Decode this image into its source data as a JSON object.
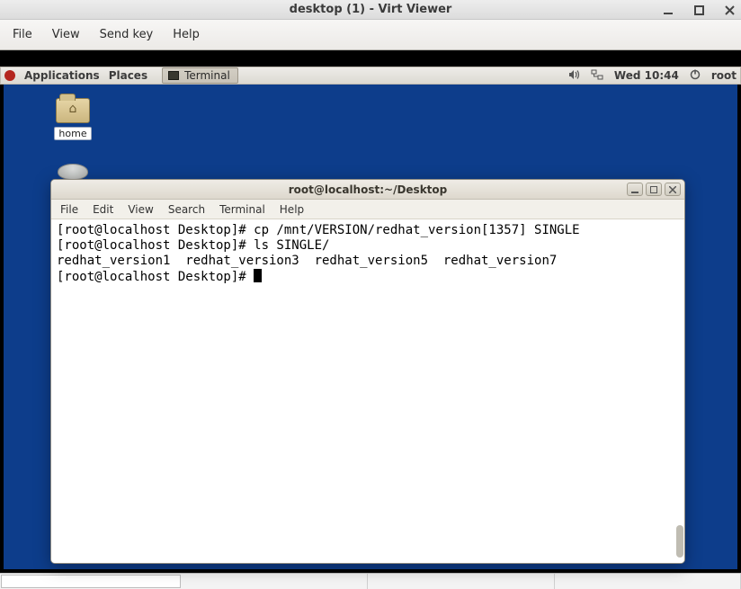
{
  "virt_viewer": {
    "title": "desktop (1) - Virt Viewer",
    "menubar": {
      "file": "File",
      "view": "View",
      "send_key": "Send key",
      "help": "Help"
    }
  },
  "gnome": {
    "applications": "Applications",
    "places": "Places",
    "task": "Terminal",
    "clock": "Wed 10:44",
    "user": "root"
  },
  "desktop": {
    "home_label": "home"
  },
  "terminal": {
    "title": "root@localhost:~/Desktop",
    "menubar": {
      "file": "File",
      "edit": "Edit",
      "view": "View",
      "search": "Search",
      "terminal": "Terminal",
      "help": "Help"
    },
    "lines": [
      "[root@localhost Desktop]# cp /mnt/VERSION/redhat_version[1357] SINGLE",
      "[root@localhost Desktop]# ls SINGLE/",
      "redhat_version1  redhat_version3  redhat_version5  redhat_version7",
      "[root@localhost Desktop]# "
    ]
  }
}
